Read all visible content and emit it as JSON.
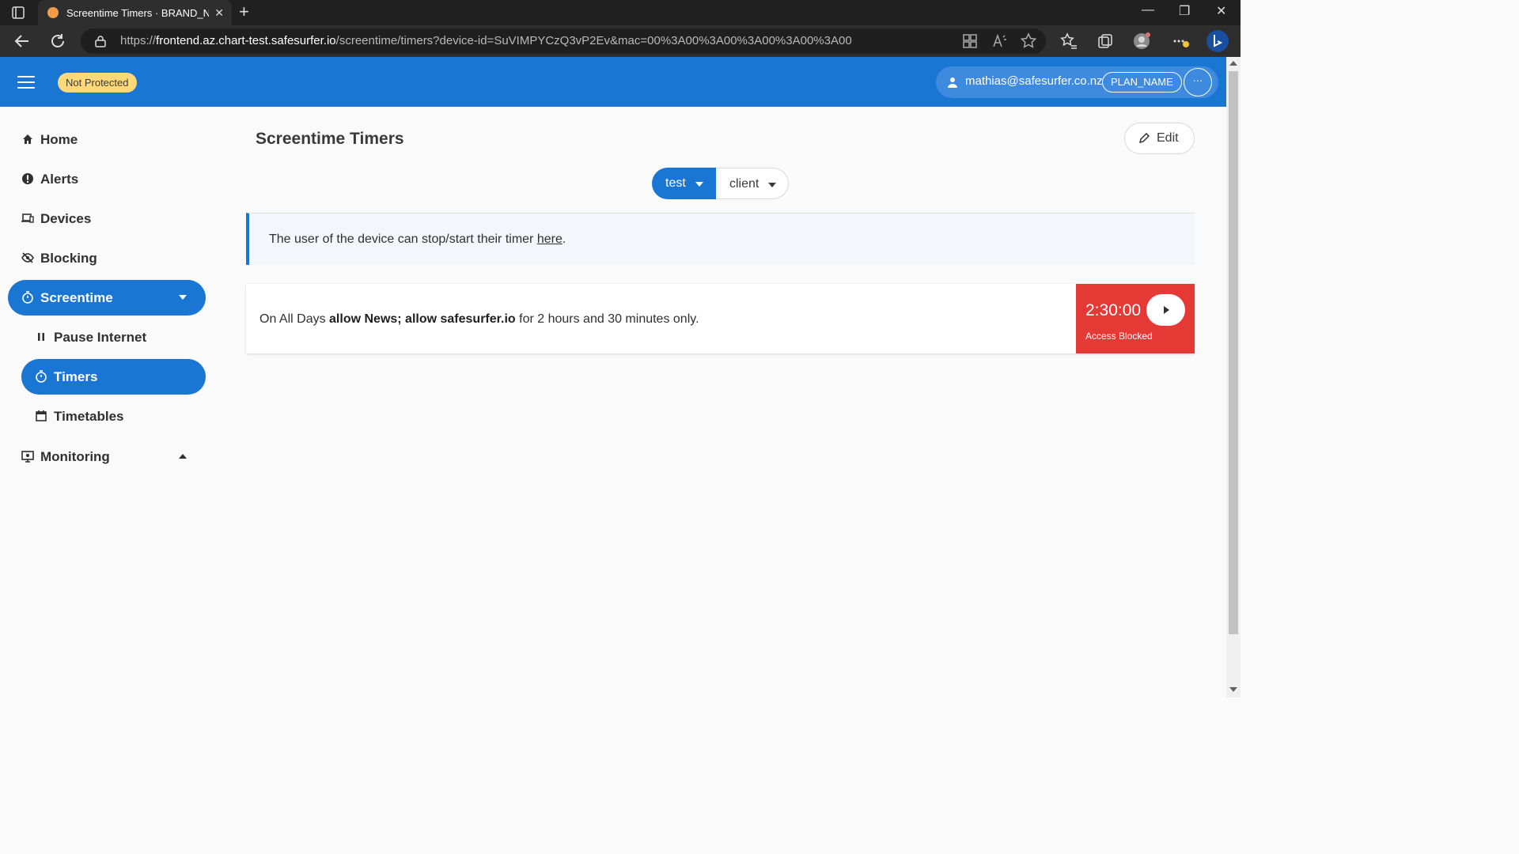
{
  "browser": {
    "tab_title": "Screentime Timers · BRAND_NAME",
    "tab_close": "✕",
    "new_tab": "+",
    "url_prefix": "https://",
    "url_host": "frontend.az.chart-test.safesurfer.io",
    "url_path": "/screentime/timers?device-id=SuVIMPYCzQ3vP2Ev&mac=00%3A00%3A00%3A00%3A00%3A00",
    "minimize": "—",
    "restore": "❐",
    "close": "✕",
    "accent_color": "#1976d2"
  },
  "header": {
    "status_badge": "Not Protected",
    "user_email": "mathias@safesurfer.co.nz",
    "plan": "PLAN_NAME",
    "more": "···"
  },
  "sidebar": {
    "items": [
      {
        "label": "Home",
        "icon": "home-icon"
      },
      {
        "label": "Alerts",
        "icon": "alert-icon"
      },
      {
        "label": "Devices",
        "icon": "devices-icon"
      },
      {
        "label": "Blocking",
        "icon": "eye-off-icon"
      },
      {
        "label": "Screentime",
        "icon": "stopwatch-icon",
        "expanded": true
      },
      {
        "label": "Pause Internet",
        "icon": "pause-icon"
      },
      {
        "label": "Timers",
        "icon": "stopwatch-icon",
        "active": true
      },
      {
        "label": "Timetables",
        "icon": "calendar-icon"
      },
      {
        "label": "Monitoring",
        "icon": "monitor-icon",
        "expanded": false
      }
    ]
  },
  "main": {
    "title": "Screentime Timers",
    "edit_label": "Edit",
    "user_select": "test",
    "device_select": "client",
    "info_text": "The user of the device can stop/start their timer ",
    "info_link": "here",
    "info_end": ".",
    "timer": {
      "prefix": "On All Days ",
      "rule": "allow News; allow safesurfer.io",
      "suffix": " for 2 hours and 30 minutes only.",
      "time": "2:30:00",
      "status": "Access Blocked",
      "status_color": "#e53935"
    }
  }
}
